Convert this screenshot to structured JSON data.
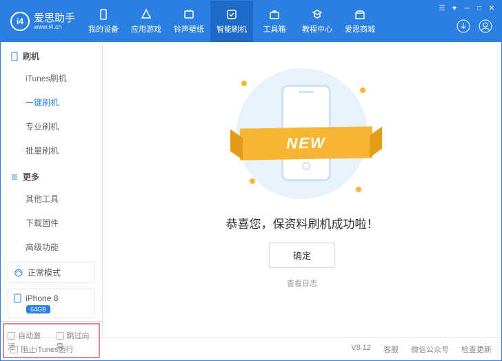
{
  "brand": {
    "name": "爱思助手",
    "sub": "www.i4.cn",
    "logoText": "i4"
  },
  "tabs": [
    {
      "label": "我的设备"
    },
    {
      "label": "应用游戏"
    },
    {
      "label": "铃声壁纸"
    },
    {
      "label": "智能刷机"
    },
    {
      "label": "工具箱"
    },
    {
      "label": "教程中心"
    },
    {
      "label": "爱思商城"
    }
  ],
  "sidebar": {
    "group1": {
      "title": "刷机",
      "items": [
        "iTunes刷机",
        "一键刷机",
        "专业刷机",
        "批量刷机"
      ],
      "active": 1
    },
    "group2": {
      "title": "更多",
      "items": [
        "其他工具",
        "下载固件",
        "高级功能"
      ]
    }
  },
  "mode": "正常模式",
  "device": {
    "name": "iPhone 8",
    "storage": "64GB"
  },
  "options": {
    "autoActivate": "自动激活",
    "skipGuide": "跳过向导"
  },
  "main": {
    "ribbon": "NEW",
    "message": "恭喜您，保资料刷机成功啦！",
    "ok": "确定",
    "viewLog": "查看日志"
  },
  "footer": {
    "stopItunes": "阻止iTunes运行",
    "version": "V8.12",
    "support": "客服",
    "wechat": "微信公众号",
    "update": "检查更新"
  }
}
